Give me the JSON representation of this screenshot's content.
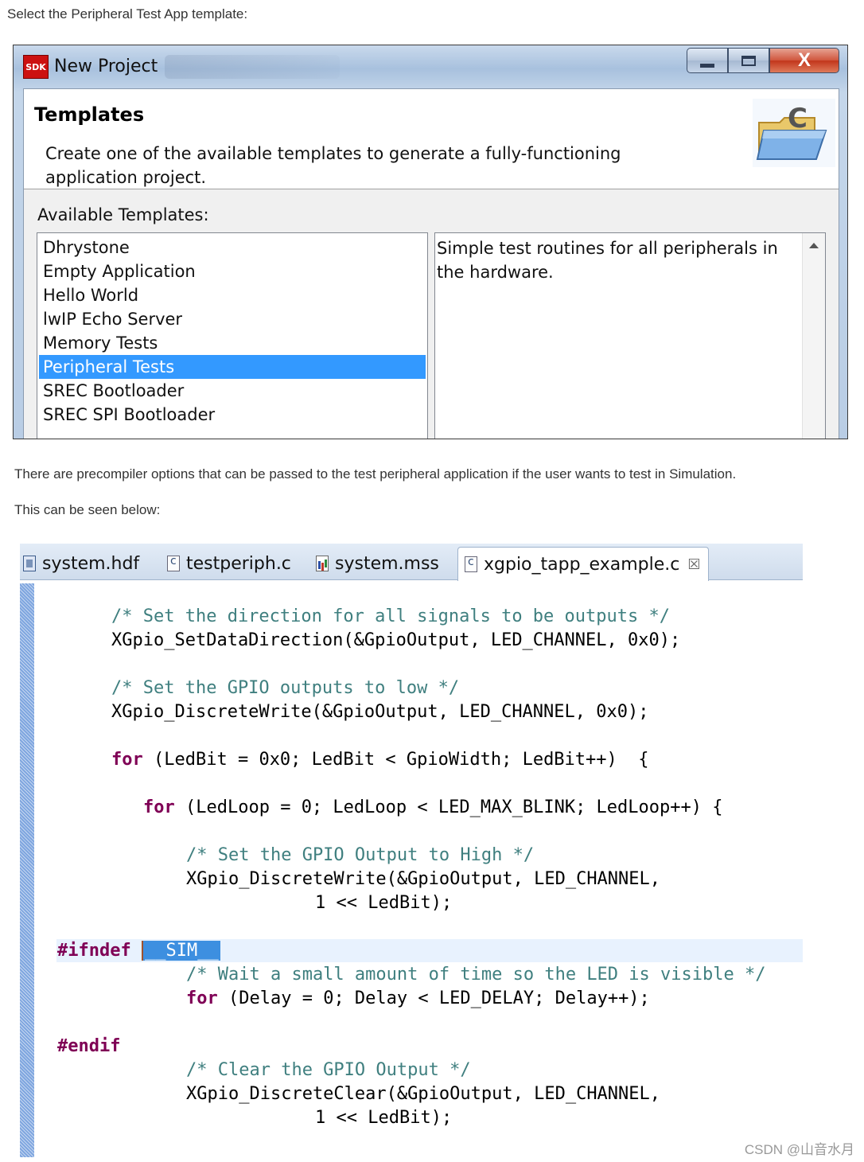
{
  "intro_text": "Select the Peripheral Test App template:",
  "dialog": {
    "logo_text": "SDK",
    "title": "New Project",
    "buttons": {
      "minimize": "minimize",
      "maximize": "maximize",
      "close": "X"
    },
    "banner": {
      "title": "Templates",
      "description": "Create one of the available templates to generate a fully-functioning application project."
    },
    "available_label": "Available Templates:",
    "templates": [
      "Dhrystone",
      "Empty Application",
      "Hello World",
      "lwIP Echo Server",
      "Memory Tests",
      "Peripheral Tests",
      "SREC Bootloader",
      "SREC SPI Bootloader"
    ],
    "selected_template": "Peripheral Tests",
    "template_description": "Simple test routines for all peripherals in the hardware."
  },
  "precompiler_text": "There are precompiler options that can be passed to the test peripheral application if the user wants to test in Simulation.",
  "seen_below_text": "This can be seen below:",
  "editor": {
    "tabs": [
      {
        "label": "system.hdf",
        "icon": "hdf-file-icon"
      },
      {
        "label": "testperiph.c",
        "icon": "c-file-icon"
      },
      {
        "label": "system.mss",
        "icon": "mss-file-icon"
      },
      {
        "label": "xgpio_tapp_example.c",
        "icon": "c-file-icon",
        "active": true,
        "close": "☒"
      }
    ],
    "code": {
      "c1": "/* Set the direction for all signals to be outputs */",
      "l1": "XGpio_SetDataDirection(&GpioOutput, LED_CHANNEL, 0x0);",
      "c2": "/* Set the GPIO outputs to low */",
      "l2": "XGpio_DiscreteWrite(&GpioOutput, LED_CHANNEL, 0x0);",
      "kw_for": "for",
      "l3": " (LedBit = 0x0; LedBit < GpioWidth; LedBit++)  {",
      "l4": " (LedLoop = 0; LedLoop < LED_MAX_BLINK; LedLoop++) {",
      "c3": "/* Set the GPIO Output to High */",
      "l5a": "XGpio_DiscreteWrite(&GpioOutput, LED_CHANNEL,",
      "l5b": "1 << LedBit);",
      "ifndef": "#ifndef",
      "sim": "__SIM__",
      "c4": "/* Wait a small amount of time so the LED is visible */",
      "l6": " (Delay = 0; Delay < LED_DELAY; Delay++);",
      "endif": "#endif",
      "c5": "/* Clear the GPIO Output */",
      "l7a": "XGpio_DiscreteClear(&GpioOutput, LED_CHANNEL,",
      "l7b": "1 << LedBit);"
    }
  },
  "watermark": "CSDN @山音水月",
  "colors": {
    "selection": "#3399ff",
    "keyword": "#7f0055",
    "comment": "#3f7f7f",
    "gutter": "#7fa6df"
  }
}
